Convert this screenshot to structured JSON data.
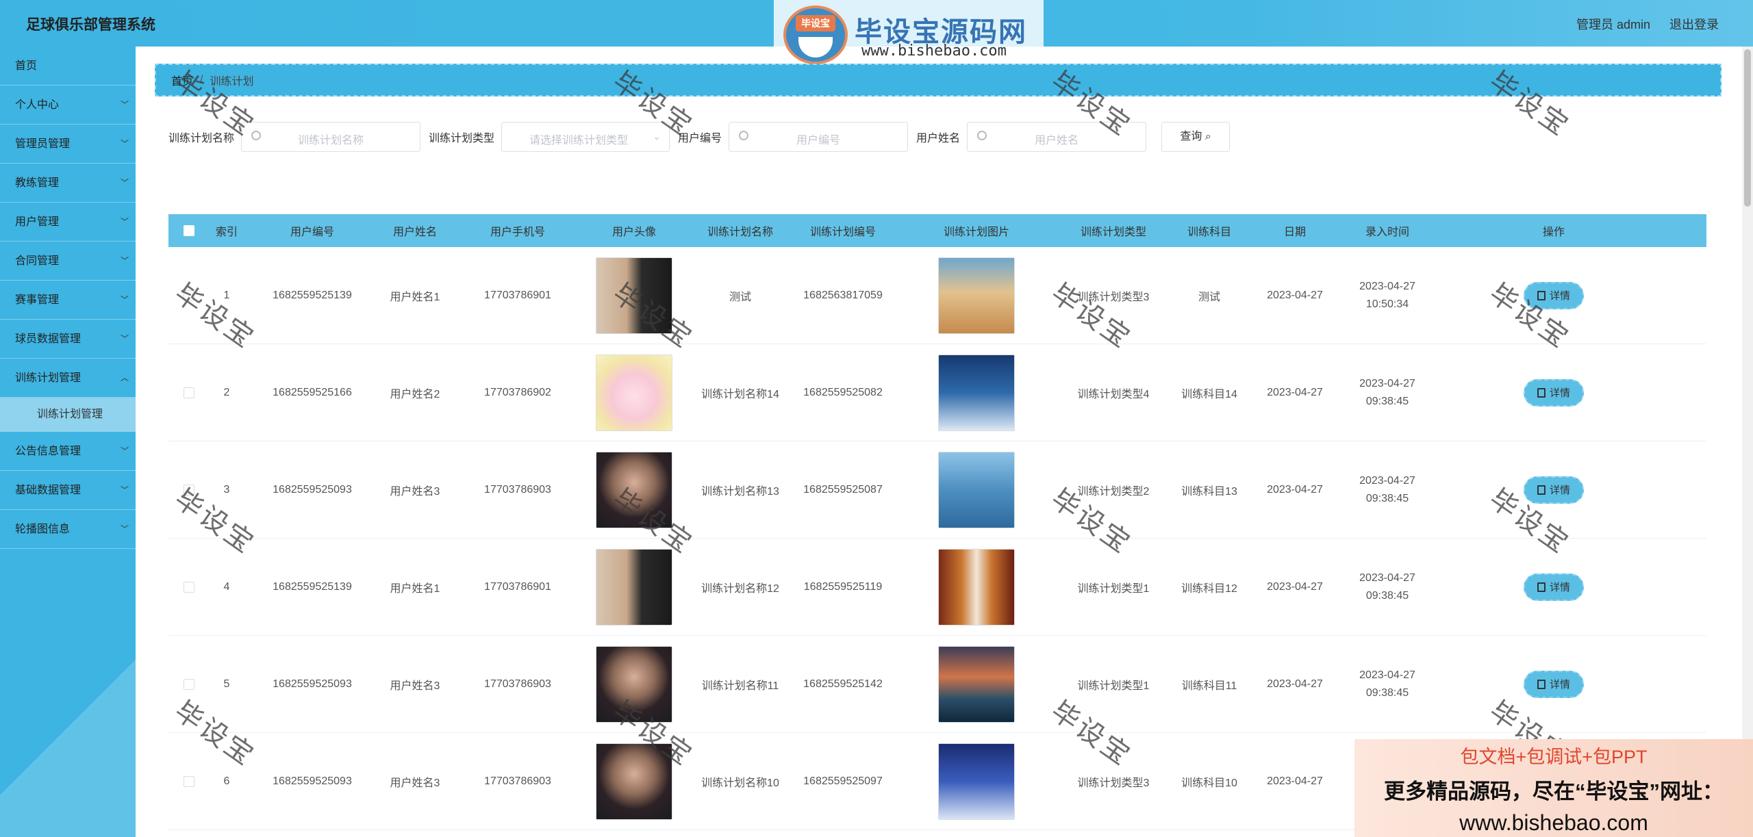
{
  "app": {
    "title": "足球俱乐部管理系统"
  },
  "header": {
    "admin_label": "管理员 admin",
    "logout_label": "退出登录"
  },
  "logo": {
    "badge": "毕设宝",
    "name": "毕设宝源码网",
    "url": "www.bishebao.com"
  },
  "sidebar": {
    "items": [
      {
        "label": "首页",
        "expandable": false
      },
      {
        "label": "个人中心",
        "expandable": true
      },
      {
        "label": "管理员管理",
        "expandable": true
      },
      {
        "label": "教练管理",
        "expandable": true
      },
      {
        "label": "用户管理",
        "expandable": true
      },
      {
        "label": "合同管理",
        "expandable": true
      },
      {
        "label": "赛事管理",
        "expandable": true
      },
      {
        "label": "球员数据管理",
        "expandable": true
      },
      {
        "label": "训练计划管理",
        "expandable": true,
        "expanded": true
      },
      {
        "label": "公告信息管理",
        "expandable": true
      },
      {
        "label": "基础数据管理",
        "expandable": true
      },
      {
        "label": "轮播图信息",
        "expandable": true
      }
    ],
    "sub_item": "训练计划管理"
  },
  "breadcrumb": {
    "home": "首页",
    "current": "训练计划"
  },
  "search": {
    "plan_name_label": "训练计划名称",
    "plan_name_placeholder": "训练计划名称",
    "plan_type_label": "训练计划类型",
    "plan_type_placeholder": "请选择训练计划类型",
    "user_no_label": "用户编号",
    "user_no_placeholder": "用户编号",
    "user_name_label": "用户姓名",
    "user_name_placeholder": "用户姓名",
    "query_label": "查询"
  },
  "table": {
    "headers": {
      "index": "索引",
      "user_no": "用户编号",
      "user_name": "用户姓名",
      "phone": "用户手机号",
      "avatar": "用户头像",
      "plan_name": "训练计划名称",
      "plan_no": "训练计划编号",
      "plan_image": "训练计划图片",
      "plan_type": "训练计划类型",
      "subject": "训练科目",
      "date": "日期",
      "created": "录入时间",
      "action": "操作"
    },
    "detail_label": "详情",
    "rows": [
      {
        "index": "1",
        "user_no": "1682559525139",
        "user_name": "用户姓名1",
        "phone": "17703786901",
        "plan_name": "测试",
        "plan_no": "1682563817059",
        "plan_type": "训练计划类型3",
        "subject": "测试",
        "date": "2023-04-27",
        "created": "2023-04-27 10:50:34",
        "avatar": "photo-room",
        "image": "desert"
      },
      {
        "index": "2",
        "user_no": "1682559525166",
        "user_name": "用户姓名2",
        "phone": "17703786902",
        "plan_name": "训练计划名称14",
        "plan_no": "1682559525082",
        "plan_type": "训练计划类型4",
        "subject": "训练科目14",
        "date": "2023-04-27",
        "created": "2023-04-27 09:38:45",
        "avatar": "anime-girl",
        "image": "snow-house"
      },
      {
        "index": "3",
        "user_no": "1682559525093",
        "user_name": "用户姓名3",
        "phone": "17703786903",
        "plan_name": "训练计划名称13",
        "plan_no": "1682559525087",
        "plan_type": "训练计划类型2",
        "subject": "训练科目13",
        "date": "2023-04-27",
        "created": "2023-04-27 09:38:45",
        "avatar": "man-selfie",
        "image": "lake"
      },
      {
        "index": "4",
        "user_no": "1682559525139",
        "user_name": "用户姓名1",
        "phone": "17703786901",
        "plan_name": "训练计划名称12",
        "plan_no": "1682559525119",
        "plan_type": "训练计划类型1",
        "subject": "训练科目12",
        "date": "2023-04-27",
        "created": "2023-04-27 09:38:45",
        "avatar": "photo-room",
        "image": "corridor"
      },
      {
        "index": "5",
        "user_no": "1682559525093",
        "user_name": "用户姓名3",
        "phone": "17703786903",
        "plan_name": "训练计划名称11",
        "plan_no": "1682559525142",
        "plan_type": "训练计划类型1",
        "subject": "训练科目11",
        "date": "2023-04-27",
        "created": "2023-04-27 09:38:45",
        "avatar": "man-selfie",
        "image": "sunset-sea"
      },
      {
        "index": "6",
        "user_no": "1682559525093",
        "user_name": "用户姓名3",
        "phone": "17703786903",
        "plan_name": "训练计划名称10",
        "plan_no": "1682559525097",
        "plan_type": "训练计划类型3",
        "subject": "训练科目10",
        "date": "2023-04-27",
        "created": "",
        "avatar": "man-selfie",
        "image": "night-sky"
      }
    ]
  },
  "watermark": "毕设宝",
  "promo": {
    "line1": "包文档+包调试+包PPT",
    "line2": "更多精品源码，尽在“毕设宝”网址：",
    "line3": "www.bishebao.com"
  },
  "colors": {
    "primary": "#3db4e2",
    "table_header": "#62c1e6",
    "detail_button": "#5bbfe5"
  }
}
